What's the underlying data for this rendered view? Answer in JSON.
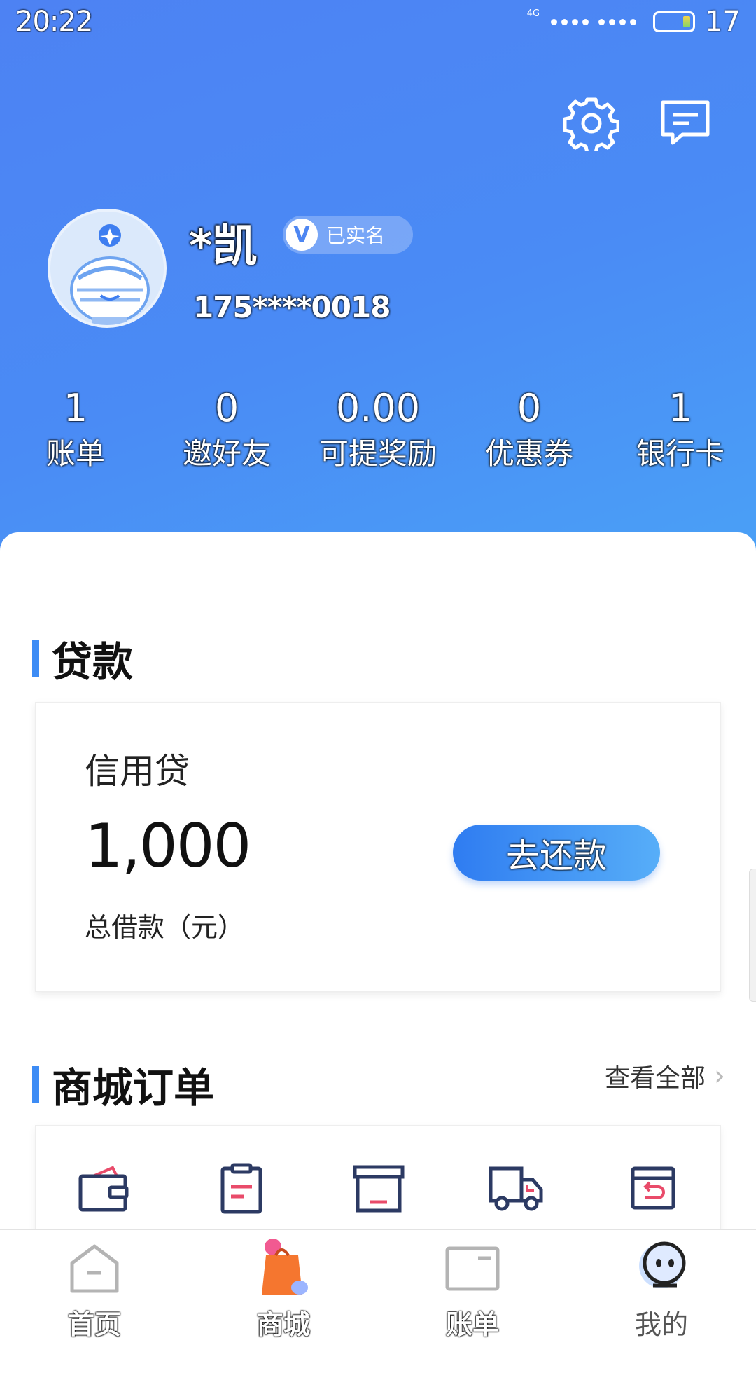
{
  "status_bar": {
    "time": "20:22",
    "network": "4G",
    "battery": "17"
  },
  "header": {
    "settings_icon": "gear-icon",
    "message_icon": "message-icon",
    "user": {
      "name": "*凯",
      "verified_label": "已实名",
      "verified_icon": "V",
      "phone": "175****0018"
    },
    "stats": [
      {
        "value": "1",
        "label": "账单"
      },
      {
        "value": "0",
        "label": "邀好友"
      },
      {
        "value": "0.00",
        "label": "可提奖励"
      },
      {
        "value": "0",
        "label": "优惠券"
      },
      {
        "value": "1",
        "label": "银行卡"
      }
    ]
  },
  "loan_section": {
    "title": "贷款",
    "card": {
      "type": "信用贷",
      "amount": "1,000",
      "amount_label": "总借款（元）",
      "action": "去还款"
    }
  },
  "orders_section": {
    "title": "商城订单",
    "view_all": "查看全部",
    "icons": [
      "wallet-icon",
      "clipboard-icon",
      "box-icon",
      "truck-icon",
      "return-icon"
    ]
  },
  "tabbar": {
    "tabs": [
      {
        "label": "首页",
        "icon": "home-icon"
      },
      {
        "label": "商城",
        "icon": "shopping-bag-icon"
      },
      {
        "label": "账单",
        "icon": "bill-icon"
      },
      {
        "label": "我的",
        "icon": "profile-icon",
        "selected": true
      }
    ]
  },
  "colors": {
    "accent": "#3d8cf5",
    "header_start": "#4d82f3",
    "header_end": "#4aa0f6"
  }
}
